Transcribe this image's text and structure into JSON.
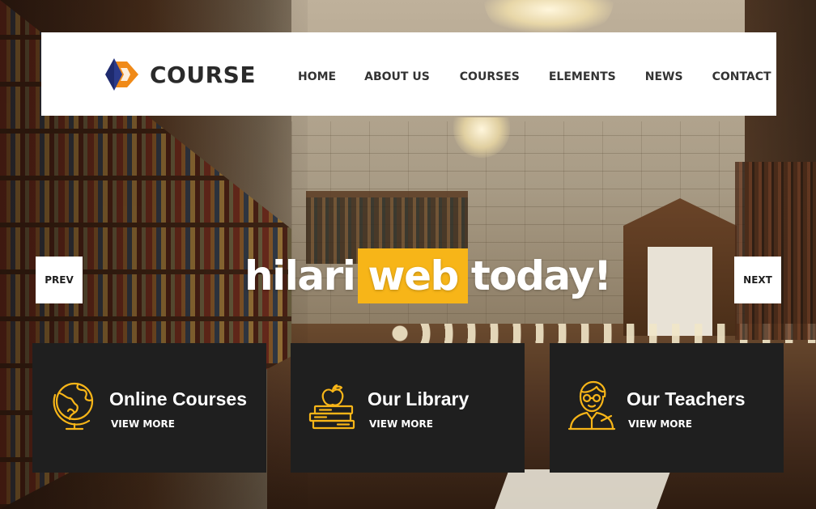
{
  "brand": {
    "name": "COURSE",
    "accent_color": "#f7b518",
    "mark_colors": [
      "#1e2a6e",
      "#f08a18"
    ]
  },
  "nav": {
    "items": [
      {
        "label": "HOME"
      },
      {
        "label": "ABOUT US"
      },
      {
        "label": "COURSES"
      },
      {
        "label": "ELEMENTS"
      },
      {
        "label": "NEWS"
      },
      {
        "label": "CONTACT"
      }
    ]
  },
  "slider": {
    "prev_label": "PREV",
    "next_label": "NEXT",
    "headline_before": "hilari",
    "headline_highlight": "web",
    "headline_after": "today!"
  },
  "features": [
    {
      "title": "Online Courses",
      "link": "VIEW MORE",
      "icon": "globe-icon"
    },
    {
      "title": "Our Library",
      "link": "VIEW MORE",
      "icon": "books-apple-icon"
    },
    {
      "title": "Our Teachers",
      "link": "VIEW MORE",
      "icon": "teacher-icon"
    }
  ],
  "colors": {
    "card_bg": "#1f1f1f",
    "icon_color": "#f7b518",
    "header_bg": "#ffffff"
  }
}
